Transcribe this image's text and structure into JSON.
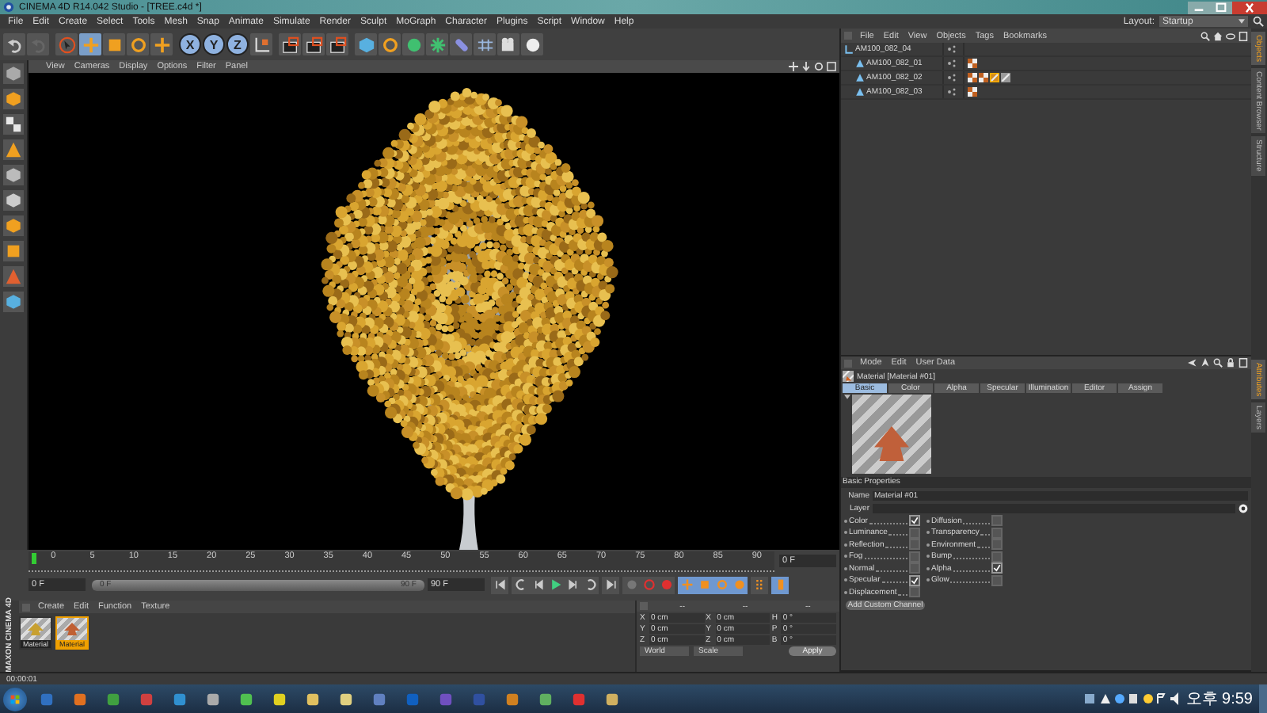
{
  "window": {
    "title": "CINEMA 4D R14.042 Studio - [TREE.c4d *]"
  },
  "menu": [
    "File",
    "Edit",
    "Create",
    "Select",
    "Tools",
    "Mesh",
    "Snap",
    "Animate",
    "Simulate",
    "Render",
    "Sculpt",
    "MoGraph",
    "Character",
    "Plugins",
    "Script",
    "Window",
    "Help"
  ],
  "layout": {
    "label": "Layout:",
    "value": "Startup"
  },
  "axis_buttons": [
    {
      "label": "X",
      "on": true
    },
    {
      "label": "Y",
      "on": true
    },
    {
      "label": "Z",
      "on": true
    }
  ],
  "viewport": {
    "menu": [
      "View",
      "Cameras",
      "Display",
      "Options",
      "Filter",
      "Panel"
    ]
  },
  "timeline": {
    "ruler_labels": [
      "0",
      "5",
      "10",
      "15",
      "20",
      "25",
      "30",
      "35",
      "40",
      "45",
      "50",
      "55",
      "60",
      "65",
      "70",
      "75",
      "80",
      "85",
      "90"
    ],
    "current_frame": "0 F",
    "start": "0 F",
    "range_start": "0 F",
    "range_end": "90 F",
    "level": 1,
    "end": "90 F"
  },
  "material_manager": {
    "menu": [
      "Create",
      "Edit",
      "Function",
      "Texture"
    ],
    "materials": [
      {
        "name": "Material",
        "selected": false,
        "color": "#c8a030"
      },
      {
        "name": "Material",
        "selected": true,
        "color": "#c06034"
      }
    ]
  },
  "coordinates": {
    "headers": [
      "--",
      "--",
      "--"
    ],
    "rows": [
      [
        {
          "label": "X",
          "value": "0 cm"
        },
        {
          "label": "X",
          "value": "0 cm"
        },
        {
          "label": "H",
          "value": "0 °"
        }
      ],
      [
        {
          "label": "Y",
          "value": "0 cm"
        },
        {
          "label": "Y",
          "value": "0 cm"
        },
        {
          "label": "P",
          "value": "0 °"
        }
      ],
      [
        {
          "label": "Z",
          "value": "0 cm"
        },
        {
          "label": "Z",
          "value": "0 cm"
        },
        {
          "label": "B",
          "value": "0 °"
        }
      ]
    ],
    "modes": [
      "World",
      "Scale"
    ],
    "button": "Apply"
  },
  "logo": "MAXON CINEMA 4D",
  "status_bar": "00:00:01",
  "object_manager": {
    "menu": [
      "File",
      "Edit",
      "View",
      "Objects",
      "Tags",
      "Bookmarks"
    ],
    "objects": [
      {
        "name": "AM100_082_04",
        "kind": "null",
        "children": [
          {
            "name": "AM100_082_01",
            "kind": "polygon",
            "tags": [
              {
                "kind": "texture",
                "selected": false
              }
            ]
          },
          {
            "name": "AM100_082_02",
            "kind": "polygon",
            "tags": [
              {
                "kind": "texture",
                "selected": false
              },
              {
                "kind": "texture",
                "selected": false
              },
              {
                "kind": "material",
                "selected": true
              },
              {
                "kind": "material",
                "selected": false
              }
            ]
          },
          {
            "name": "AM100_082_03",
            "kind": "polygon",
            "tags": [
              {
                "kind": "texture",
                "selected": false
              }
            ]
          }
        ]
      }
    ]
  },
  "side_tabs_top": [
    {
      "label": "Objects",
      "selected": true
    },
    {
      "label": "Content Browser",
      "selected": false
    },
    {
      "label": "Structure",
      "selected": false
    }
  ],
  "side_tabs_bottom": [
    {
      "label": "Attributes",
      "selected": true
    },
    {
      "label": "Layers",
      "selected": false
    }
  ],
  "attributes": {
    "menu": [
      "Mode",
      "Edit",
      "User Data"
    ],
    "header": "Material [Material #01]",
    "tabs": [
      {
        "label": "Basic",
        "selected": true
      },
      {
        "label": "Color",
        "selected": false
      },
      {
        "label": "Alpha",
        "selected": false
      },
      {
        "label": "Specular",
        "selected": false
      },
      {
        "label": "Illumination",
        "selected": false
      },
      {
        "label": "Editor",
        "selected": false
      },
      {
        "label": "Assign",
        "selected": false
      }
    ],
    "section": "Basic Properties",
    "fields": [
      {
        "label": "Name",
        "value": "Material #01"
      },
      {
        "label": "Layer"
      }
    ],
    "channels": [
      {
        "label": "Color",
        "checked": true
      },
      {
        "label": "Diffusion",
        "checked": false
      },
      {
        "label": "Luminance",
        "checked": false
      },
      {
        "label": "Transparency",
        "checked": false
      },
      {
        "label": "Reflection",
        "checked": false
      },
      {
        "label": "Environment",
        "checked": false
      },
      {
        "label": "Fog",
        "checked": false
      },
      {
        "label": "Bump",
        "checked": false
      },
      {
        "label": "Normal",
        "checked": false
      },
      {
        "label": "Alpha",
        "checked": true
      },
      {
        "label": "Specular",
        "checked": true
      },
      {
        "label": "Glow",
        "checked": false
      },
      {
        "label": "Displacement",
        "checked": false
      }
    ],
    "button": "Add Custom Channel"
  },
  "taskbar": {
    "clock": "오후 9:59"
  }
}
